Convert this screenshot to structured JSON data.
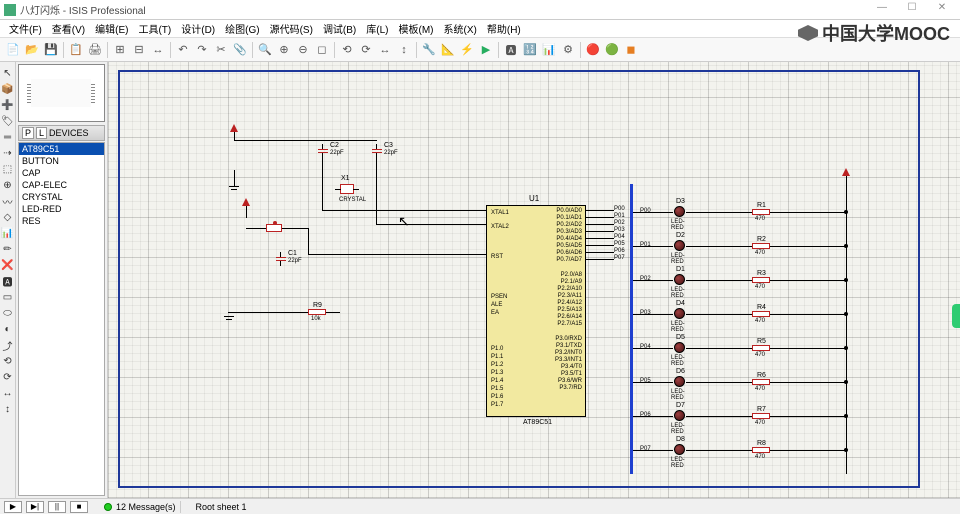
{
  "title": "八灯闪烁 - ISIS Professional",
  "window_buttons": {
    "min": "—",
    "max": "☐",
    "close": "✕"
  },
  "menus": [
    "文件(F)",
    "查看(V)",
    "编辑(E)",
    "工具(T)",
    "设计(D)",
    "绘图(G)",
    "源代码(S)",
    "调试(B)",
    "库(L)",
    "模板(M)",
    "系统(X)",
    "帮助(H)"
  ],
  "watermark": "中国大学MOOC",
  "toolbar_icons": [
    {
      "g": "📄"
    },
    {
      "g": "📂"
    },
    {
      "g": "💾"
    },
    {
      "sep": true
    },
    {
      "g": "📋"
    },
    {
      "g": "🖨"
    },
    {
      "sep": true
    },
    {
      "g": "⊞"
    },
    {
      "g": "⊟"
    },
    {
      "g": "↔"
    },
    {
      "sep": true
    },
    {
      "g": "↶"
    },
    {
      "g": "↷"
    },
    {
      "g": "✂"
    },
    {
      "g": "📎"
    },
    {
      "sep": true
    },
    {
      "g": "🔍"
    },
    {
      "g": "⊕"
    },
    {
      "g": "⊖"
    },
    {
      "g": "◻"
    },
    {
      "sep": true
    },
    {
      "g": "⟲"
    },
    {
      "g": "⟳"
    },
    {
      "g": "↔"
    },
    {
      "g": "↕"
    },
    {
      "sep": true
    },
    {
      "g": "🔧"
    },
    {
      "g": "📐"
    },
    {
      "g": "⚡",
      "c": "color-orange"
    },
    {
      "g": "▶",
      "c": "color-green"
    },
    {
      "sep": true
    },
    {
      "g": "🅰"
    },
    {
      "g": "🔢"
    },
    {
      "g": "📊",
      "c": "color-blue"
    },
    {
      "g": "⚙"
    },
    {
      "sep": true
    },
    {
      "g": "🔴",
      "c": "color-red"
    },
    {
      "g": "🟢",
      "c": "color-green"
    },
    {
      "g": "◼",
      "c": "color-orange"
    }
  ],
  "left_tools": [
    "↖",
    "📦",
    "➕",
    "🏷",
    "═",
    "⇢",
    "⬚",
    "⊕",
    "〰",
    "◇",
    "📊",
    "✏",
    "❌",
    "🅰",
    "▭",
    "⬭",
    "◐",
    "⤴",
    "⟲",
    "⟳",
    "↔",
    "↕"
  ],
  "devices_header": {
    "p": "P",
    "l": "L",
    "title": "DEVICES"
  },
  "devices": [
    "AT89C51",
    "BUTTON",
    "CAP",
    "CAP-ELEC",
    "CRYSTAL",
    "LED-RED",
    "RES"
  ],
  "components": {
    "u1": {
      "ref": "U1",
      "name": "AT89C51",
      "pins_left": [
        "XTAL1",
        "XTAL2",
        "",
        "RST",
        "",
        "",
        "PSEN",
        "ALE",
        "EA",
        "",
        "P1.0",
        "P1.1",
        "P1.2",
        "P1.3",
        "P1.4",
        "P1.5",
        "P1.6",
        "P1.7"
      ],
      "pins_right": [
        "P0.0/AD0",
        "P0.1/AD1",
        "P0.2/AD2",
        "P0.3/AD3",
        "P0.4/AD4",
        "P0.5/AD5",
        "P0.6/AD6",
        "P0.7/AD7",
        "",
        "P2.0/A8",
        "P2.1/A9",
        "P2.2/A10",
        "P2.3/A11",
        "P2.4/A12",
        "P2.5/A13",
        "P2.6/A14",
        "P2.7/A15",
        "",
        "P3.0/RXD",
        "P3.1/TXD",
        "P3.2/INT0",
        "P3.3/INT1",
        "P3.4/T0",
        "P3.5/T1",
        "P3.6/WR",
        "P3.7/RD"
      ]
    },
    "c1": {
      "ref": "C1",
      "val": "22pF"
    },
    "c2": {
      "ref": "C2",
      "val": "22pF"
    },
    "c3": {
      "ref": "C3",
      "val": "22pF"
    },
    "x1": {
      "ref": "X1",
      "val": "CRYSTAL"
    },
    "r9": {
      "ref": "R9",
      "val": "10k"
    },
    "leds": [
      {
        "ref": "D3",
        "val": "LED-RED"
      },
      {
        "ref": "D2",
        "val": "LED-RED"
      },
      {
        "ref": "D1",
        "val": "LED-RED"
      },
      {
        "ref": "D4",
        "val": "LED-RED"
      },
      {
        "ref": "D5",
        "val": "LED-RED"
      },
      {
        "ref": "D6",
        "val": "LED-RED"
      },
      {
        "ref": "D7",
        "val": "LED-RED"
      },
      {
        "ref": "D8",
        "val": "LED-RED"
      }
    ],
    "resistors": [
      {
        "ref": "R1",
        "val": "470"
      },
      {
        "ref": "R2",
        "val": "470"
      },
      {
        "ref": "R3",
        "val": "470"
      },
      {
        "ref": "R4",
        "val": "470"
      },
      {
        "ref": "R5",
        "val": "470"
      },
      {
        "ref": "R6",
        "val": "470"
      },
      {
        "ref": "R7",
        "val": "470"
      },
      {
        "ref": "R8",
        "val": "470"
      }
    ],
    "nets": [
      "P00",
      "P01",
      "P02",
      "P03",
      "P04",
      "P05",
      "P06",
      "P07"
    ]
  },
  "status": {
    "play": "▶",
    "step": "▶|",
    "pause": "||",
    "stop": "■",
    "messages": "12 Message(s)",
    "sheet": "Root sheet 1"
  }
}
